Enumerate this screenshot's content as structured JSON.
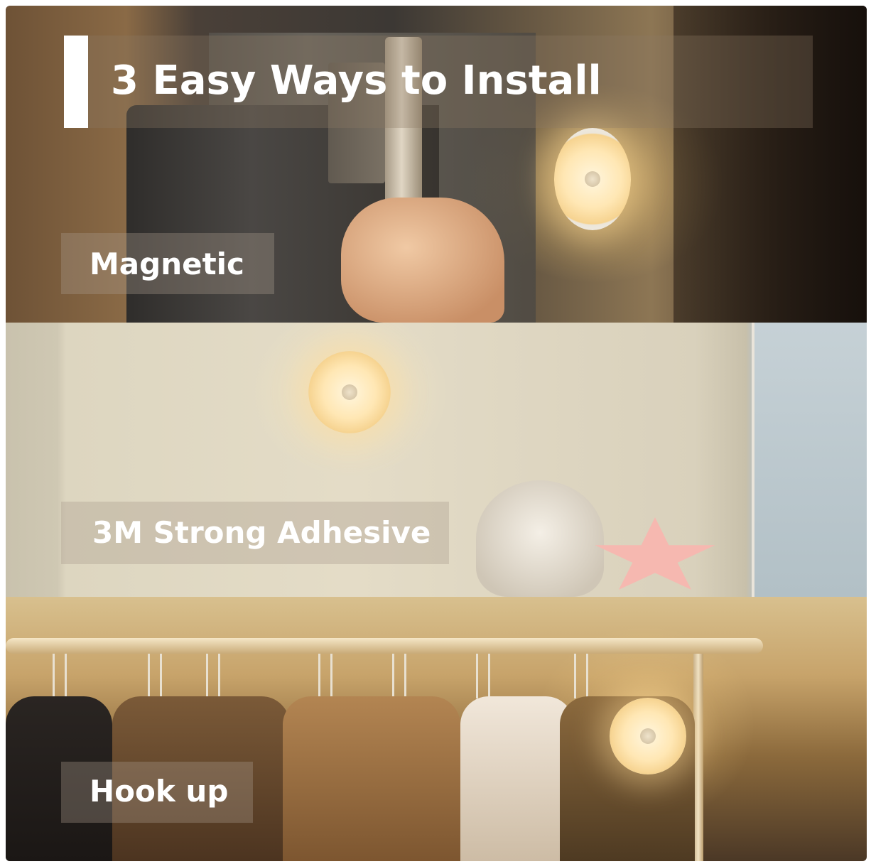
{
  "heading": {
    "title": "3 Easy Ways to Install"
  },
  "methods": [
    {
      "label": "Magnetic"
    },
    {
      "label": "3M Strong Adhesive"
    },
    {
      "label": "Hook up"
    }
  ],
  "icons": {
    "accent_bar": "white-accent-bar",
    "product": "round-motion-sensor-light"
  },
  "colors": {
    "text": "#ffffff",
    "accent_bar": "#ffffff",
    "warm_light": "#ffe7b4"
  }
}
